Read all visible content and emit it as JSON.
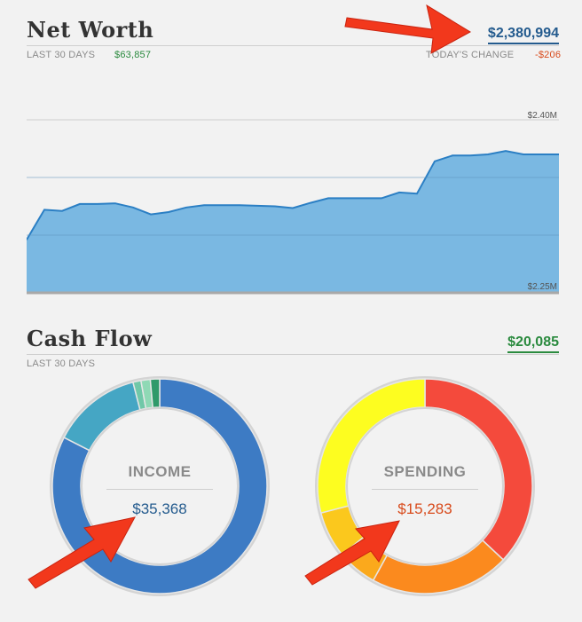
{
  "net_worth": {
    "title": "Net Worth",
    "total": "$2,380,994",
    "period_label": "LAST 30 DAYS",
    "period_change": "$63,857",
    "today_label": "TODAY'S CHANGE",
    "today_change": "-$206",
    "colors": {
      "positive": "#2a8a3e",
      "negative": "#d84a1b",
      "link": "#245b8e",
      "fill": "#7ab8e2",
      "line": "#2b7fc4"
    }
  },
  "chart_data": {
    "type": "area",
    "title": "",
    "xlabel": "",
    "ylabel": "",
    "y_tick_labels": [
      "$2.40M",
      "$2.25M"
    ],
    "ylim": [
      2250000,
      2400000
    ],
    "x": [
      1,
      2,
      3,
      4,
      5,
      6,
      7,
      8,
      9,
      10,
      11,
      12,
      13,
      14,
      15,
      16,
      17,
      18,
      19,
      20,
      21,
      22,
      23,
      24,
      25,
      26,
      27,
      28,
      29,
      30,
      31
    ],
    "values": [
      2296000,
      2322000,
      2321000,
      2327000,
      2327000,
      2327500,
      2324000,
      2318000,
      2320000,
      2324000,
      2326000,
      2326000,
      2326000,
      2325500,
      2325000,
      2323500,
      2328000,
      2332000,
      2332000,
      2332000,
      2332000,
      2337000,
      2336000,
      2364000,
      2369000,
      2369000,
      2370000,
      2373000,
      2370000,
      2370000,
      2370000
    ],
    "grid": true,
    "legend": "none"
  },
  "cash_flow": {
    "title": "Cash Flow",
    "total": "$20,085",
    "period_label": "LAST 30 DAYS",
    "income": {
      "label": "INCOME",
      "value": "$35,368",
      "segments": [
        {
          "value": 82.5,
          "color": "#3d7bc4"
        },
        {
          "value": 13.5,
          "color": "#45a6c4"
        },
        {
          "value": 1.2,
          "color": "#70c8a8"
        },
        {
          "value": 1.4,
          "color": "#8fd9b5"
        },
        {
          "value": 1.4,
          "color": "#2f9a6a"
        }
      ]
    },
    "spending": {
      "label": "SPENDING",
      "value": "$15,283",
      "segments": [
        {
          "value": 37,
          "color": "#f44a3c"
        },
        {
          "value": 21,
          "color": "#fb8a1e"
        },
        {
          "value": 6,
          "color": "#fba91c"
        },
        {
          "value": 7,
          "color": "#fbc81d"
        },
        {
          "value": 29,
          "color": "#fdfd20"
        }
      ]
    }
  }
}
